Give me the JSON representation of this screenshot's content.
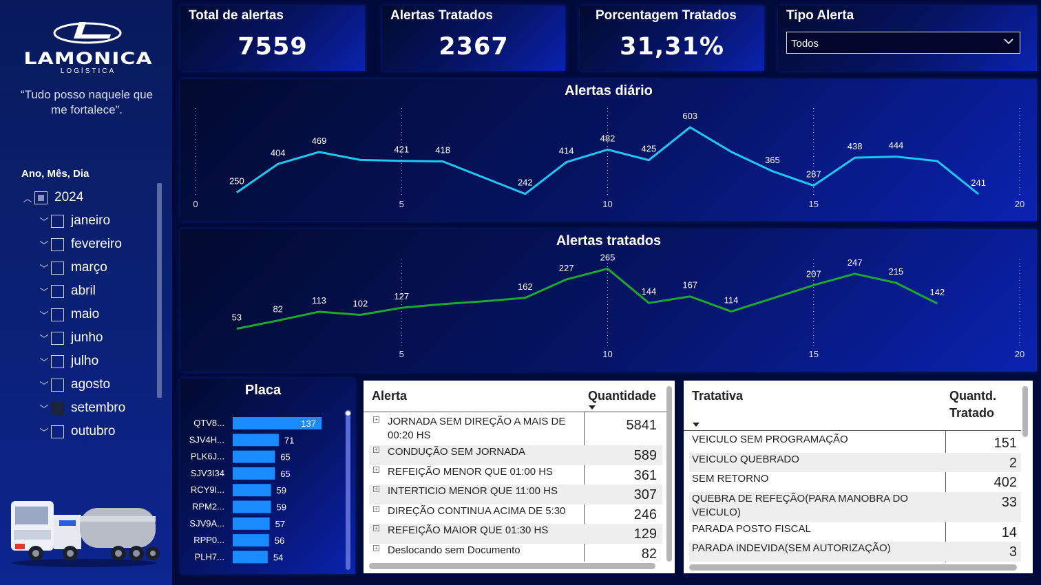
{
  "sidebar": {
    "logo_text": "LAMONICA",
    "logo_sub": "LOGÍSTICA",
    "motto_line1": "“Tudo posso naquele que",
    "motto_line2": "me fortalece”.",
    "slicer_title": "Ano, Mês, Dia",
    "year": "2024",
    "months": [
      "janeiro",
      "fevereiro",
      "março",
      "abril",
      "maio",
      "junho",
      "julho",
      "agosto",
      "setembro",
      "outubro"
    ],
    "selected_month": "setembro"
  },
  "kpis": [
    {
      "label": "Total de alertas",
      "value": "7559"
    },
    {
      "label": "Alertas Tratados",
      "value": "2367"
    },
    {
      "label": "Porcentagem Tratados",
      "value": "31,31%"
    }
  ],
  "filter": {
    "label": "Tipo Alerta",
    "value": "Todos"
  },
  "chart_data": [
    {
      "type": "line",
      "title": "Alertas diário",
      "x": [
        2,
        4,
        6,
        8,
        10,
        12,
        14,
        16,
        18,
        20,
        22,
        24,
        26,
        28,
        30,
        32,
        34,
        36,
        38
      ],
      "x_display": [
        1,
        2,
        3,
        4,
        5,
        6,
        7,
        8,
        9,
        10,
        11,
        12,
        13,
        14,
        15,
        16,
        17,
        18,
        19
      ],
      "values": [
        250,
        404,
        469,
        421,
        418,
        242,
        414,
        482,
        425,
        603,
        365,
        287,
        438,
        444,
        241
      ],
      "points": [
        [
          1,
          250
        ],
        [
          3,
          404
        ],
        [
          4,
          469
        ],
        [
          5,
          421
        ],
        [
          6,
          418
        ],
        [
          8,
          242
        ],
        [
          9,
          414
        ],
        [
          10,
          482
        ],
        [
          11,
          425
        ],
        [
          12,
          603
        ],
        [
          14,
          365
        ],
        [
          15,
          287
        ],
        [
          16,
          438
        ],
        [
          17,
          444
        ],
        [
          19,
          241
        ]
      ],
      "all_points": [
        [
          1,
          250
        ],
        [
          2,
          404
        ],
        [
          3,
          469
        ],
        [
          4,
          426
        ],
        [
          5,
          421
        ],
        [
          6,
          418
        ],
        [
          7,
          330
        ],
        [
          8,
          242
        ],
        [
          9,
          414
        ],
        [
          10,
          482
        ],
        [
          11,
          425
        ],
        [
          12,
          603
        ],
        [
          13,
          470
        ],
        [
          14,
          365
        ],
        [
          15,
          287
        ],
        [
          16,
          438
        ],
        [
          17,
          444
        ],
        [
          18,
          420
        ],
        [
          19,
          241
        ]
      ],
      "labeled": [
        1,
        2,
        3,
        5,
        6,
        8,
        9,
        10,
        11,
        12,
        14,
        15,
        16,
        17,
        19
      ],
      "xticks": [
        0,
        5,
        10,
        15,
        20
      ],
      "xlim": [
        0,
        20
      ],
      "color": "#1ec8f5"
    },
    {
      "type": "line",
      "title": "Alertas tratados",
      "all_points": [
        [
          1,
          53
        ],
        [
          2,
          82
        ],
        [
          3,
          113
        ],
        [
          4,
          102
        ],
        [
          5,
          127
        ],
        [
          6,
          140
        ],
        [
          7,
          150
        ],
        [
          8,
          162
        ],
        [
          9,
          227
        ],
        [
          10,
          265
        ],
        [
          11,
          144
        ],
        [
          12,
          167
        ],
        [
          13,
          114
        ],
        [
          14,
          160
        ],
        [
          15,
          207
        ],
        [
          16,
          247
        ],
        [
          17,
          215
        ],
        [
          18,
          142
        ]
      ],
      "labeled": [
        1,
        2,
        3,
        4,
        5,
        8,
        9,
        10,
        11,
        12,
        13,
        15,
        16,
        17,
        18
      ],
      "xticks": [
        5,
        10,
        15,
        20
      ],
      "xlim": [
        0,
        20
      ],
      "color": "#1aa82e"
    },
    {
      "type": "bar",
      "title": "Placa",
      "categories": [
        "QTV8...",
        "SJV4H...",
        "PLK6J...",
        "SJV3I34",
        "RCY9I...",
        "RPM2...",
        "SJV9A...",
        "RPP0...",
        "PLH7..."
      ],
      "values": [
        137,
        71,
        65,
        65,
        59,
        59,
        57,
        56,
        54
      ],
      "color": "#1a8cff"
    }
  ],
  "alert_table": {
    "col1": "Alerta",
    "col2": "Quantidade",
    "rows": [
      {
        "label_l1": "JORNADA SEM DIREÇÃO A MAIS DE",
        "label_l2": "00:20 HS",
        "value": "5841"
      },
      {
        "label_l1": "CONDUÇÃO SEM JORNADA",
        "label_l2": "",
        "value": "589"
      },
      {
        "label_l1": "REFEIÇÃO MENOR QUE 01:00 HS",
        "label_l2": "",
        "value": "361"
      },
      {
        "label_l1": "INTERTICIO MENOR QUE 11:00 HS",
        "label_l2": "",
        "value": "307"
      },
      {
        "label_l1": "DIREÇÃO CONTINUA ACIMA DE 5:30",
        "label_l2": "",
        "value": "246"
      },
      {
        "label_l1": "REFEIÇÃO MAIOR QUE 01:30 HS",
        "label_l2": "",
        "value": "129"
      },
      {
        "label_l1": "Deslocando sem Documento",
        "label_l2": "",
        "value": "82"
      }
    ]
  },
  "treat_table": {
    "col1": "Tratativa",
    "col2_l1": "Quantd.",
    "col2_l2": "Tratado",
    "rows": [
      {
        "label_l1": "VEICULO SEM PROGRAMAÇÃO",
        "label_l2": "",
        "value": "151"
      },
      {
        "label_l1": "VEICULO QUEBRADO",
        "label_l2": "",
        "value": "2"
      },
      {
        "label_l1": "SEM RETORNO",
        "label_l2": "",
        "value": "402"
      },
      {
        "label_l1": "QUEBRA DE REFEÇÃO(PARA MANOBRA DO",
        "label_l2": "VEICULO)",
        "value": "33"
      },
      {
        "label_l1": "PARADA POSTO FISCAL",
        "label_l2": "",
        "value": "14"
      },
      {
        "label_l1": "PARADA INDEVIDA(SEM AUTORIZAÇÃO)",
        "label_l2": "",
        "value": "3"
      }
    ]
  }
}
